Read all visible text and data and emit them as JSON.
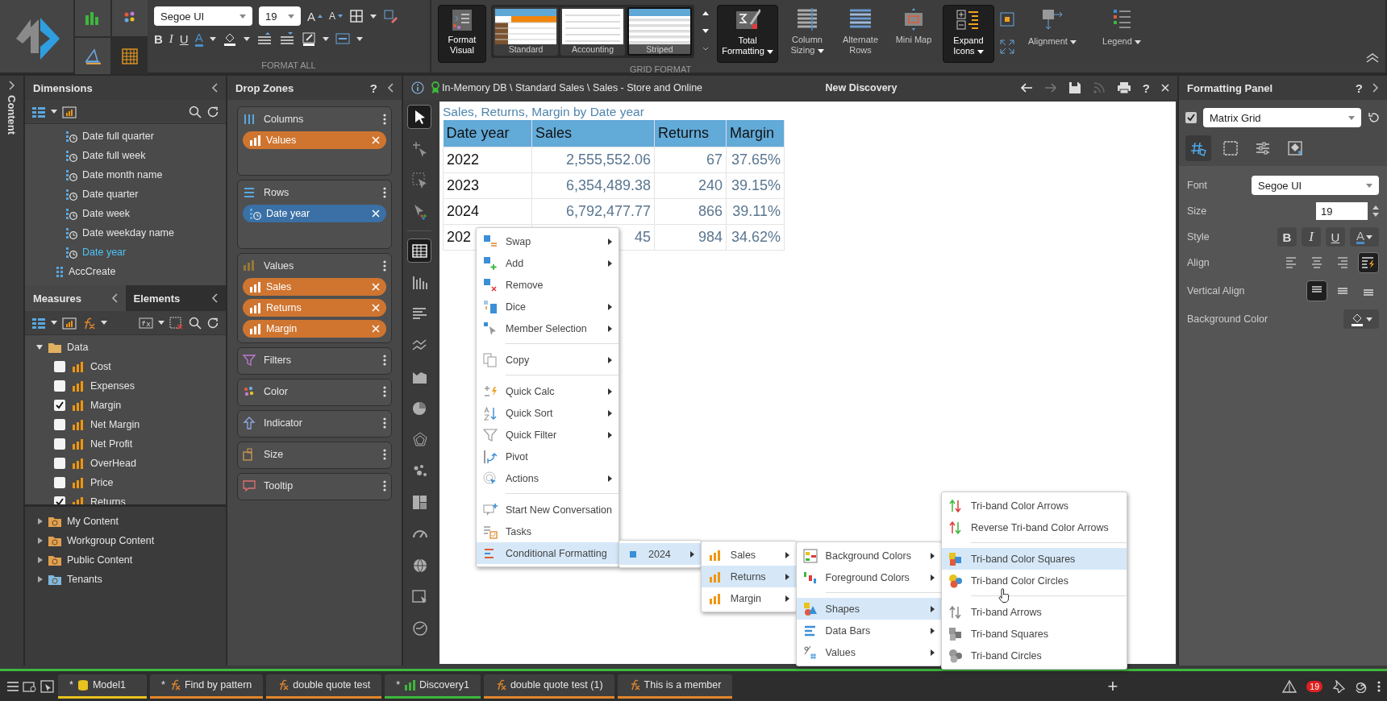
{
  "ribbon": {
    "view_buttons": [
      {
        "kind": "chart",
        "selected": false
      },
      {
        "kind": "palette",
        "selected": false
      },
      {
        "kind": "properties",
        "selected": false
      },
      {
        "kind": "grid",
        "selected": true
      }
    ],
    "font": "Segoe UI",
    "size": "19",
    "grow": "A",
    "shrink": "A",
    "bold": "B",
    "italic": "I",
    "underline": "U",
    "font_color": "A",
    "format_all": "FORMAT ALL",
    "format_visual": "Format Visual",
    "styles": [
      {
        "label": "Standard",
        "kind": "standard",
        "selected": false
      },
      {
        "label": "Accounting",
        "kind": "accounting",
        "selected": false
      },
      {
        "label": "Striped",
        "kind": "striped",
        "selected": true
      }
    ],
    "tools": [
      {
        "label": "Total Formatting",
        "kind": "total",
        "dropdown": true,
        "active": true
      },
      {
        "label": "Column Sizing",
        "kind": "sizing",
        "dropdown": true,
        "active": false
      },
      {
        "label": "Alternate Rows",
        "kind": "rows",
        "dropdown": false,
        "active": false
      },
      {
        "label": "Mini Map",
        "kind": "map",
        "dropdown": false,
        "active": false
      },
      {
        "label": "Expand Icons",
        "kind": "expand",
        "dropdown": true,
        "active": true
      }
    ],
    "menus": [
      {
        "label": "Alignment",
        "kind": "alignment"
      },
      {
        "label": "Legend",
        "kind": "legend"
      }
    ],
    "grid_format": "GRID FORMAT"
  },
  "rail": {
    "label": "Content"
  },
  "dimensions": {
    "title": "Dimensions",
    "items": [
      {
        "label": "Date full quarter",
        "kind": "time",
        "selected": false
      },
      {
        "label": "Date full week",
        "kind": "time",
        "selected": false
      },
      {
        "label": "Date month name",
        "kind": "time",
        "selected": false
      },
      {
        "label": "Date quarter",
        "kind": "time",
        "selected": false
      },
      {
        "label": "Date week",
        "kind": "time",
        "selected": false
      },
      {
        "label": "Date weekday name",
        "kind": "time",
        "selected": false
      },
      {
        "label": "Date year",
        "kind": "time",
        "selected": true
      },
      {
        "label": "AccCreate",
        "kind": "attribute",
        "selected": false
      }
    ]
  },
  "measures": {
    "tabs": [
      {
        "label": "Measures",
        "selected": true
      },
      {
        "label": "Elements",
        "selected": false
      }
    ],
    "tree": [
      {
        "label": "Data",
        "expanded": true,
        "children": [
          {
            "label": "Cost",
            "checked": false
          },
          {
            "label": "Expenses",
            "checked": false
          },
          {
            "label": "Margin",
            "checked": true
          },
          {
            "label": "Net Margin",
            "checked": false
          },
          {
            "label": "Net Profit",
            "checked": false
          },
          {
            "label": "OverHead",
            "checked": false
          },
          {
            "label": "Price",
            "checked": false
          },
          {
            "label": "Returns",
            "checked": true
          }
        ]
      }
    ]
  },
  "content_tree": [
    {
      "label": "My Content",
      "kind": "user",
      "expanded": false
    },
    {
      "label": "Workgroup Content",
      "kind": "group",
      "expanded": false
    },
    {
      "label": "Public Content",
      "kind": "public",
      "expanded": false
    },
    {
      "label": "Tenants",
      "kind": "tenant",
      "expanded": false
    }
  ],
  "drop_zones": {
    "title": "Drop Zones",
    "help": "?",
    "zones": [
      {
        "title": "Columns",
        "kind": "columns",
        "chips": [
          {
            "label": "Values",
            "kind": "measure"
          }
        ]
      },
      {
        "title": "Rows",
        "kind": "rows",
        "chips": [
          {
            "label": "Date year",
            "kind": "dimension"
          }
        ]
      },
      {
        "title": "Values",
        "kind": "values",
        "chips": [
          {
            "label": "Sales",
            "kind": "measure"
          },
          {
            "label": "Returns",
            "kind": "measure"
          },
          {
            "label": "Margin",
            "kind": "measure"
          }
        ]
      },
      {
        "title": "Filters",
        "kind": "filters"
      },
      {
        "title": "Color",
        "kind": "color"
      },
      {
        "title": "Indicator",
        "kind": "indicator"
      },
      {
        "title": "Size",
        "kind": "size"
      },
      {
        "title": "Tooltip",
        "kind": "tooltip"
      }
    ]
  },
  "discovery": {
    "breadcrumb": "In-Memory DB \\ Standard Sales \\ Sales - Store and Online",
    "title": "New Discovery",
    "help": "?",
    "tools": [
      {
        "kind": "pointer",
        "selected": true
      },
      {
        "kind": "add-pointer",
        "selected": false
      },
      {
        "kind": "select-area",
        "selected": false
      },
      {
        "kind": "color-pointer",
        "selected": false
      },
      {
        "kind": "separator"
      },
      {
        "kind": "grid",
        "selected": true
      },
      {
        "kind": "column-chart",
        "selected": false
      },
      {
        "kind": "bar-chart",
        "selected": false
      },
      {
        "kind": "line-chart",
        "selected": false
      },
      {
        "kind": "area-chart",
        "selected": false
      },
      {
        "kind": "pie-chart",
        "selected": false
      },
      {
        "kind": "radar-chart",
        "selected": false
      },
      {
        "kind": "scatter-chart",
        "selected": false
      },
      {
        "kind": "treemap",
        "selected": false
      },
      {
        "kind": "gauge",
        "selected": false
      },
      {
        "kind": "globe",
        "selected": false
      },
      {
        "kind": "map",
        "selected": false
      },
      {
        "kind": "custom",
        "selected": false
      }
    ],
    "visual": {
      "title": "Sales, Returns, Margin by Date year",
      "columns": [
        "Date year",
        "Sales",
        "Returns",
        "Margin"
      ],
      "rows": [
        [
          "2022",
          "2,555,552.06",
          "67",
          "37.65%"
        ],
        [
          "2023",
          "6,354,489.38",
          "240",
          "39.15%"
        ],
        [
          "2024",
          "6,792,477.77",
          "866",
          "39.11%"
        ],
        [
          "202",
          "45",
          "984",
          "34.62%"
        ]
      ]
    }
  },
  "context_menu": {
    "items": [
      {
        "label": "Swap",
        "kind": "swap",
        "submenu": true,
        "selected": false
      },
      {
        "label": "Add",
        "kind": "add",
        "submenu": true,
        "selected": false
      },
      {
        "label": "Remove",
        "kind": "remove",
        "submenu": false,
        "selected": false
      },
      {
        "label": "Dice",
        "kind": "dice",
        "submenu": true,
        "selected": false
      },
      {
        "label": "Member Selection",
        "kind": "member",
        "submenu": true,
        "selected": false
      },
      {
        "kind": "separator"
      },
      {
        "label": "Copy",
        "kind": "copy",
        "submenu": true,
        "selected": false
      },
      {
        "kind": "separator"
      },
      {
        "label": "Quick Calc",
        "kind": "calc",
        "submenu": true,
        "selected": false
      },
      {
        "label": "Quick Sort",
        "kind": "sort",
        "submenu": true,
        "selected": false
      },
      {
        "label": "Quick Filter",
        "kind": "filter",
        "submenu": true,
        "selected": false
      },
      {
        "label": "Pivot",
        "kind": "pivot",
        "submenu": false,
        "selected": false
      },
      {
        "label": "Actions",
        "kind": "actions",
        "submenu": true,
        "selected": false
      },
      {
        "kind": "separator"
      },
      {
        "label": "Start New Conversation",
        "kind": "conversation",
        "submenu": false,
        "selected": false
      },
      {
        "label": "Tasks",
        "kind": "tasks",
        "submenu": false,
        "selected": false
      },
      {
        "label": "Conditional Formatting",
        "kind": "conditional",
        "submenu": true,
        "selected": true,
        "submenu_items": [
          {
            "label": "2024",
            "kind": "member-square",
            "submenu": true,
            "selected": true,
            "submenu_items": [
              {
                "label": "Sales",
                "kind": "measure",
                "submenu": true,
                "selected": false
              },
              {
                "label": "Returns",
                "kind": "measure",
                "submenu": true,
                "selected": true,
                "submenu_items": [
                  {
                    "label": "Background Colors",
                    "kind": "background",
                    "submenu": true,
                    "selected": false
                  },
                  {
                    "label": "Foreground Colors",
                    "kind": "foreground",
                    "submenu": true,
                    "selected": false
                  },
                  {
                    "kind": "separator"
                  },
                  {
                    "label": "Shapes",
                    "kind": "shapes",
                    "submenu": true,
                    "selected": true,
                    "submenu_items": [
                      {
                        "label": "Tri-band Color Arrows",
                        "kind": "color-arrows",
                        "submenu": false,
                        "selected": false
                      },
                      {
                        "label": "Reverse Tri-band Color Arrows",
                        "kind": "reverse-arrows",
                        "submenu": false,
                        "selected": false
                      },
                      {
                        "kind": "separator"
                      },
                      {
                        "label": "Tri-band Color Squares",
                        "kind": "color-squares",
                        "submenu": false,
                        "selected": true
                      },
                      {
                        "label": "Tri-band Color Circles",
                        "kind": "color-circles",
                        "submenu": false,
                        "selected": false
                      },
                      {
                        "kind": "separator"
                      },
                      {
                        "label": "Tri-band Arrows",
                        "kind": "arrows",
                        "submenu": false,
                        "selected": false
                      },
                      {
                        "label": "Tri-band Squares",
                        "kind": "squares",
                        "submenu": false,
                        "selected": false
                      },
                      {
                        "label": "Tri-band Circles",
                        "kind": "circles",
                        "submenu": false,
                        "selected": false
                      }
                    ]
                  },
                  {
                    "label": "Data Bars",
                    "kind": "databars",
                    "submenu": true,
                    "selected": false
                  },
                  {
                    "label": "Values",
                    "kind": "values",
                    "submenu": true,
                    "selected": false
                  }
                ]
              },
              {
                "label": "Margin",
                "kind": "measure",
                "submenu": true,
                "selected": false
              }
            ]
          }
        ]
      }
    ]
  },
  "formatting": {
    "title": "Formatting Panel",
    "help": "?",
    "enabled": true,
    "visual_type": "Matrix Grid",
    "tabs": [
      {
        "kind": "format",
        "selected": true
      },
      {
        "kind": "border",
        "selected": false
      },
      {
        "kind": "settings",
        "selected": false
      },
      {
        "kind": "fill",
        "selected": false
      }
    ],
    "font_label": "Font",
    "font": "Segoe UI",
    "size_label": "Size",
    "size": "19",
    "style_label": "Style",
    "styles": [
      {
        "label": "B",
        "kind": "bold"
      },
      {
        "label": "I",
        "kind": "italic"
      },
      {
        "label": "U",
        "kind": "underline"
      },
      {
        "label": "A",
        "kind": "color"
      }
    ],
    "align_label": "Align",
    "align": [
      {
        "kind": "left",
        "selected": false
      },
      {
        "kind": "center",
        "selected": false
      },
      {
        "kind": "right",
        "selected": false
      },
      {
        "kind": "conditional",
        "selected": true
      }
    ],
    "valign_label": "Vertical Align",
    "valign": [
      {
        "kind": "top",
        "selected": true
      },
      {
        "kind": "middle",
        "selected": false
      },
      {
        "kind": "bottom",
        "selected": false
      }
    ],
    "background_label": "Background Color"
  },
  "taskbar": {
    "tabs": [
      {
        "label": "Model1",
        "mark": "*",
        "kind": "model",
        "color": "#e8c21e"
      },
      {
        "label": "Find by pattern",
        "mark": "*",
        "kind": "formula",
        "color": "#e0862a"
      },
      {
        "label": "double quote test",
        "kind": "formula",
        "color": "#e0862a"
      },
      {
        "label": "Discovery1",
        "mark": "*",
        "kind": "discovery",
        "color": "#3db83d"
      },
      {
        "label": "double quote test (1)",
        "kind": "formula",
        "color": "#e0862a"
      },
      {
        "label": "This is a member",
        "kind": "formula",
        "color": "#e0862a"
      }
    ],
    "add": "+",
    "badge": "19"
  }
}
